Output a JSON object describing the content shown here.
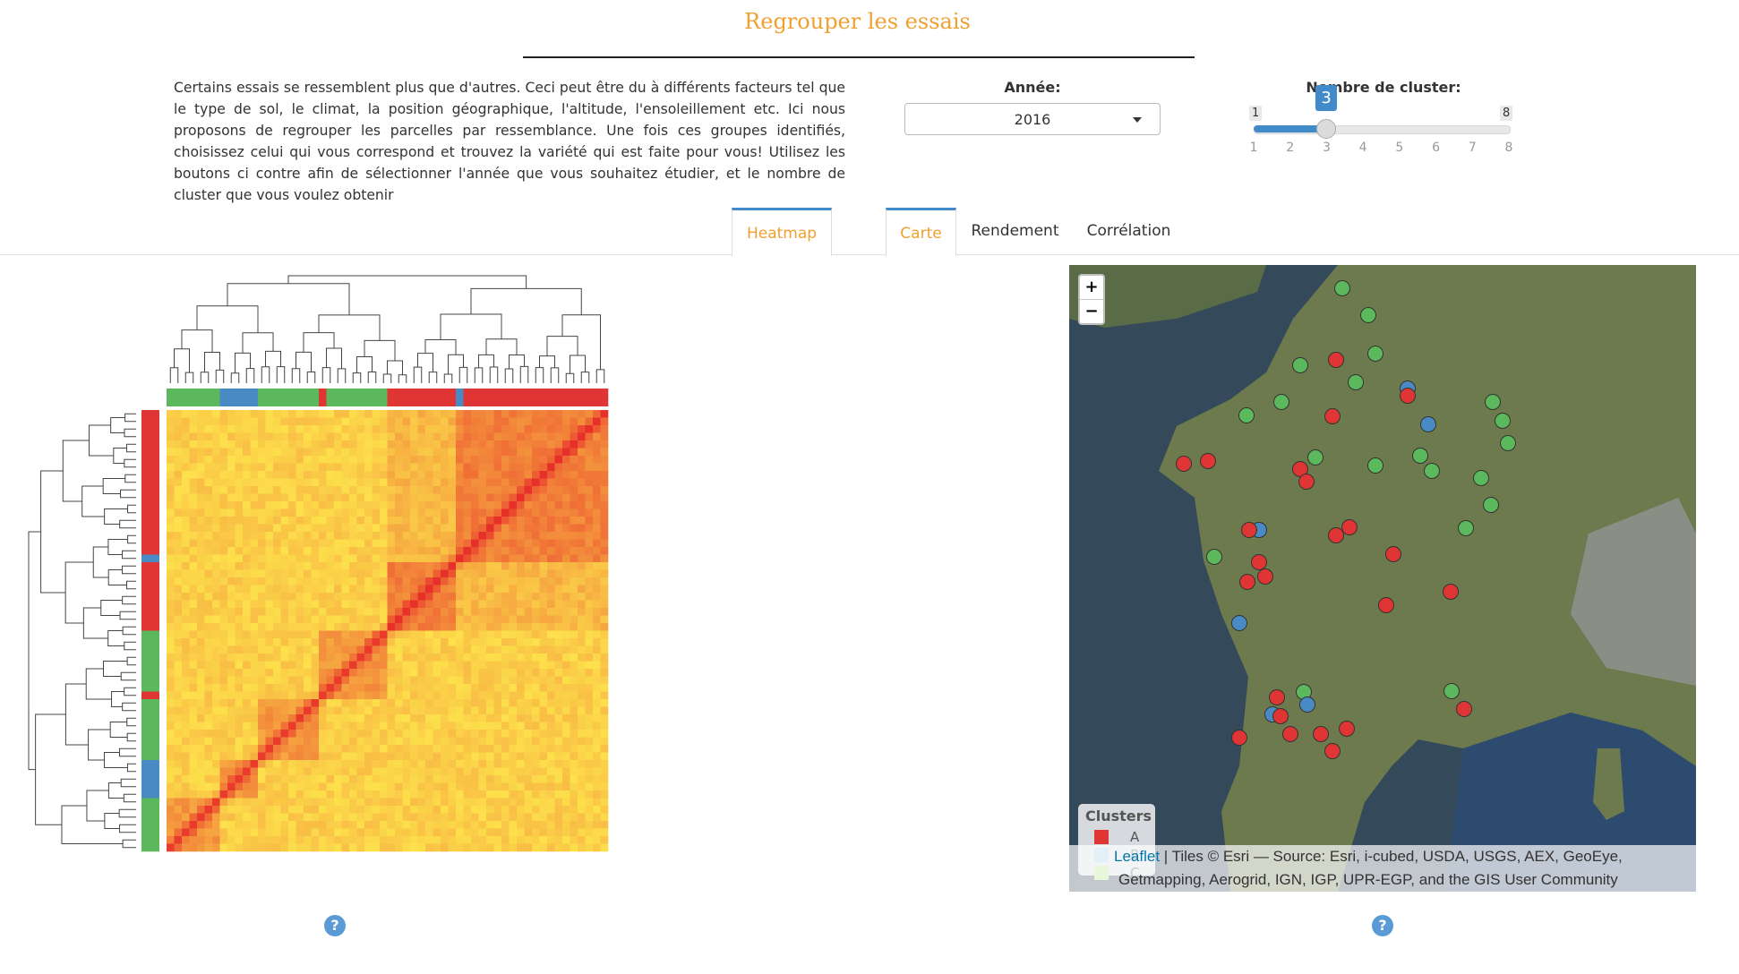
{
  "header": {
    "title": "Regrouper les essais",
    "intro": "Certains essais se ressemblent plus que d'autres. Ceci peut être du à différents facteurs tel que le type de sol, le climat, la position géographique, l'altitude, l'ensoleillement etc. Ici nous proposons de regrouper les parcelles par ressemblance. Une fois ces groupes identifiés, choisissez celui qui vous correspond et trouvez la variété qui est faite pour vous! Utilisez les boutons ci contre afin de sélectionner l'année que vous souhaitez étudier, et le nombre de cluster que vous voulez obtenir"
  },
  "controls": {
    "year_label": "Année:",
    "year_value": "2016",
    "cluster_label": "Nombre de cluster:",
    "cluster_min": "1",
    "cluster_max": "8",
    "cluster_value": 3,
    "cluster_value_text": "3",
    "cluster_ticks": [
      "1",
      "2",
      "3",
      "4",
      "5",
      "6",
      "7",
      "8"
    ]
  },
  "tabs": [
    {
      "label": "Heatmap",
      "active": true
    },
    {
      "label": "Carte",
      "active": true
    },
    {
      "label": "Rendement",
      "active": false
    },
    {
      "label": "Corrélation",
      "active": false
    }
  ],
  "colors": {
    "accent": "#f0a030",
    "primary": "#428bca",
    "cluster_red": "#e03535",
    "cluster_blue": "#4a8ac4",
    "cluster_green": "#5cb85c",
    "heat_low": "#fff44f",
    "heat_high": "#e8302a"
  },
  "heatmap": {
    "cluster_sidebar_colors": [
      "red",
      "red",
      "red",
      "red",
      "red",
      "red",
      "red",
      "red",
      "red",
      "red",
      "red",
      "red",
      "red",
      "red",
      "red",
      "red",
      "red",
      "red",
      "red",
      "blue",
      "red",
      "red",
      "red",
      "red",
      "red",
      "red",
      "red",
      "red",
      "red",
      "green",
      "green",
      "green",
      "green",
      "green",
      "green",
      "green",
      "green",
      "red",
      "green",
      "green",
      "green",
      "green",
      "green",
      "green",
      "green",
      "green",
      "blue",
      "blue",
      "blue",
      "blue",
      "blue",
      "green",
      "green",
      "green",
      "green",
      "green",
      "green",
      "green"
    ],
    "top_cluster_colors": [
      "green",
      "green",
      "green",
      "green",
      "green",
      "green",
      "green",
      "blue",
      "blue",
      "blue",
      "blue",
      "blue",
      "green",
      "green",
      "green",
      "green",
      "green",
      "green",
      "green",
      "green",
      "red",
      "green",
      "green",
      "green",
      "green",
      "green",
      "green",
      "green",
      "green",
      "red",
      "red",
      "red",
      "red",
      "red",
      "red",
      "red",
      "red",
      "red",
      "blue",
      "red",
      "red",
      "red",
      "red",
      "red",
      "red",
      "red",
      "red",
      "red",
      "red",
      "red",
      "red",
      "red",
      "red",
      "red",
      "red",
      "red",
      "red",
      "red"
    ]
  },
  "map": {
    "zoom_in": "+",
    "zoom_out": "−",
    "legend_title": "Clusters",
    "legend": [
      {
        "label": "A",
        "color": "#e03535"
      },
      {
        "label": "B",
        "color": "#a6cee3"
      },
      {
        "label": "C",
        "color": "#b2df8a"
      }
    ],
    "attribution_link": "Leaflet",
    "attribution_line1": " | Tiles © Esri — Source: Esri, i-cubed, USDA, USGS, AEX, GeoEye,",
    "attribution_line2": "Getmapping, Aerogrid, IGN, IGP, UPR-EGP, and the GIS User Community"
  },
  "help_icon": "?"
}
